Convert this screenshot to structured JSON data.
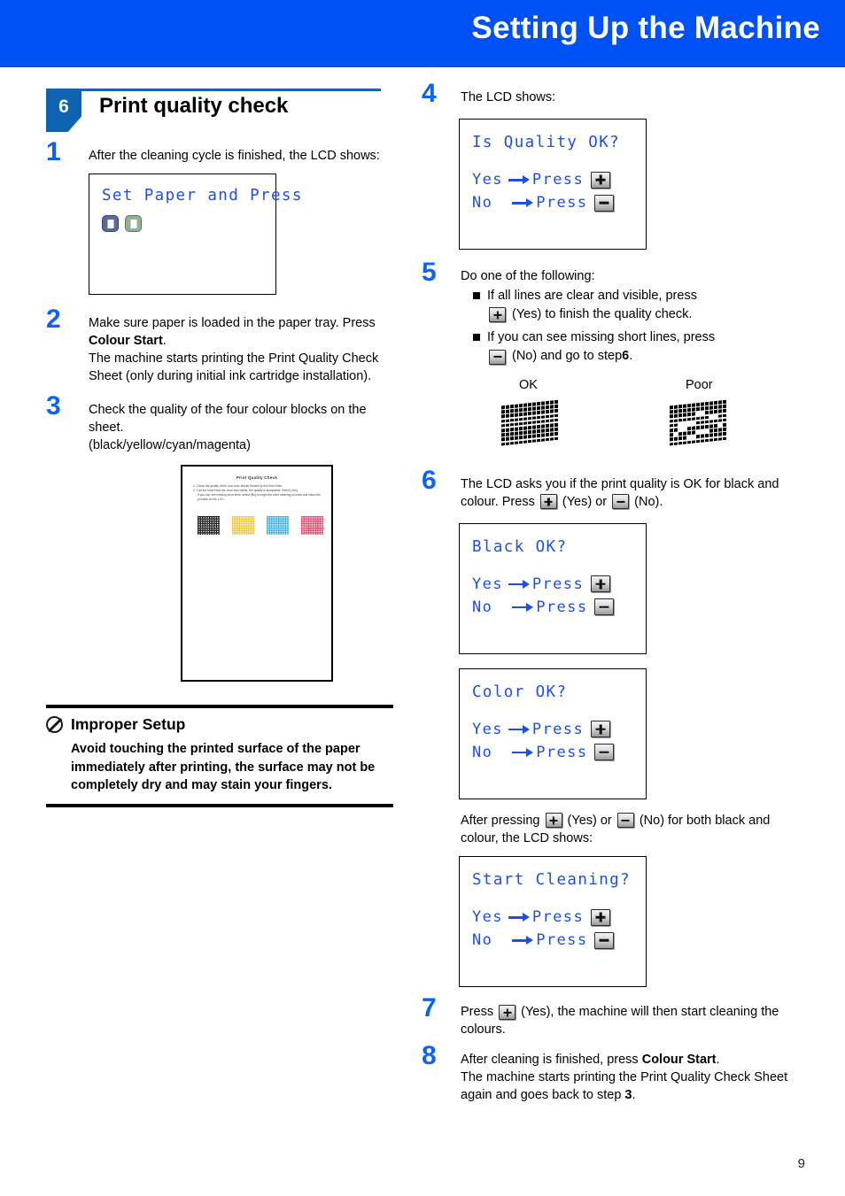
{
  "header": {
    "title": "Setting Up the Machine"
  },
  "section": {
    "number": "6",
    "title": "Print quality check"
  },
  "page_number": "9",
  "left": {
    "step1": {
      "num": "1",
      "text": "After the cleaning cycle is finished, the LCD shows:"
    },
    "lcd_setpaper": {
      "line1": "Set Paper and Press",
      "icon_mono": "mono-start-button-icon",
      "icon_colour": "colour-start-button-icon"
    },
    "step2": {
      "num": "2",
      "text_a": "Make sure paper is loaded in the paper tray. Press ",
      "bold": "Colour Start",
      "text_b": ".",
      "text_c": "The machine starts printing the Print Quality Check Sheet (only during initial ink cartridge installation)."
    },
    "step3": {
      "num": "3",
      "text_a": "Check the quality of the four colour blocks on the sheet.",
      "text_b": "(black/yellow/cyan/magenta)"
    },
    "sheet": {
      "title": "Print Quality Check",
      "instruction1": "1. Check the quality of the four color blocks formed by the short lines.",
      "instruction2": "2. If all the short lines are clear and visible, the quality is acceptable.  Select [Yes].",
      "instruction3": "If you can see missing short lines, select [No] to begin the color cleaning process and follow the prompts on the LCD.",
      "blocks": [
        "black",
        "yellow",
        "cyan",
        "magenta"
      ]
    },
    "notice": {
      "title": "Improper Setup",
      "icon": "prohibition-icon",
      "body": "Avoid touching the printed surface of the paper immediately after printing, the surface may not be completely dry and may stain your fingers."
    }
  },
  "right": {
    "step4": {
      "num": "4",
      "text": "The LCD shows:"
    },
    "lcd_quality": {
      "title": "Is Quality OK?",
      "yes_label": "Yes",
      "no_label": "No",
      "press_label": "Press",
      "yes_key": "+",
      "no_key": "-"
    },
    "step5": {
      "num": "5",
      "intro": "Do one of the following:",
      "bullet1": "If all lines are clear and visible, press",
      "bullet1_cont_a": "(Yes) to finish the quality check.",
      "bullet2": "If you can see missing short lines, press",
      "bullet2_cont_a": "(No) and go to step ",
      "bullet2_step": "6",
      "bullet2_cont_b": "."
    },
    "samples": {
      "ok_label": "OK",
      "poor_label": "Poor"
    },
    "step6": {
      "num": "6",
      "text_a": "The LCD asks you if the print quality is OK for black and colour. Press ",
      "text_b": " (Yes) or ",
      "text_c": " (No)."
    },
    "lcd_black": {
      "title": "Black OK?",
      "yes_label": "Yes",
      "no_label": "No",
      "press_label": "Press"
    },
    "lcd_color": {
      "title": "Color OK?",
      "yes_label": "Yes",
      "no_label": "No",
      "press_label": "Press"
    },
    "after_note": {
      "text_a": "After pressing ",
      "text_b": " (Yes) or ",
      "text_c": " (No) for both black and colour, the LCD shows:"
    },
    "lcd_cleaning": {
      "title": "Start Cleaning?",
      "yes_label": "Yes",
      "no_label": "No",
      "press_label": "Press"
    },
    "step7": {
      "num": "7",
      "text_a": "Press ",
      "text_b": " (Yes), the machine will then start cleaning the colours."
    },
    "step8": {
      "num": "8",
      "text_a": "After cleaning is finished, press ",
      "bold": "Colour Start",
      "text_b": ".",
      "text_c": "The machine starts printing the Print Quality Check Sheet again and goes back to step ",
      "step_ref": "3",
      "text_d": "."
    }
  },
  "colors": {
    "header_blue": "#0051f5",
    "step_number_blue": "#0d63f5",
    "badge_blue": "#0d63ad",
    "lcd_text_blue": "#1f4fe0"
  }
}
